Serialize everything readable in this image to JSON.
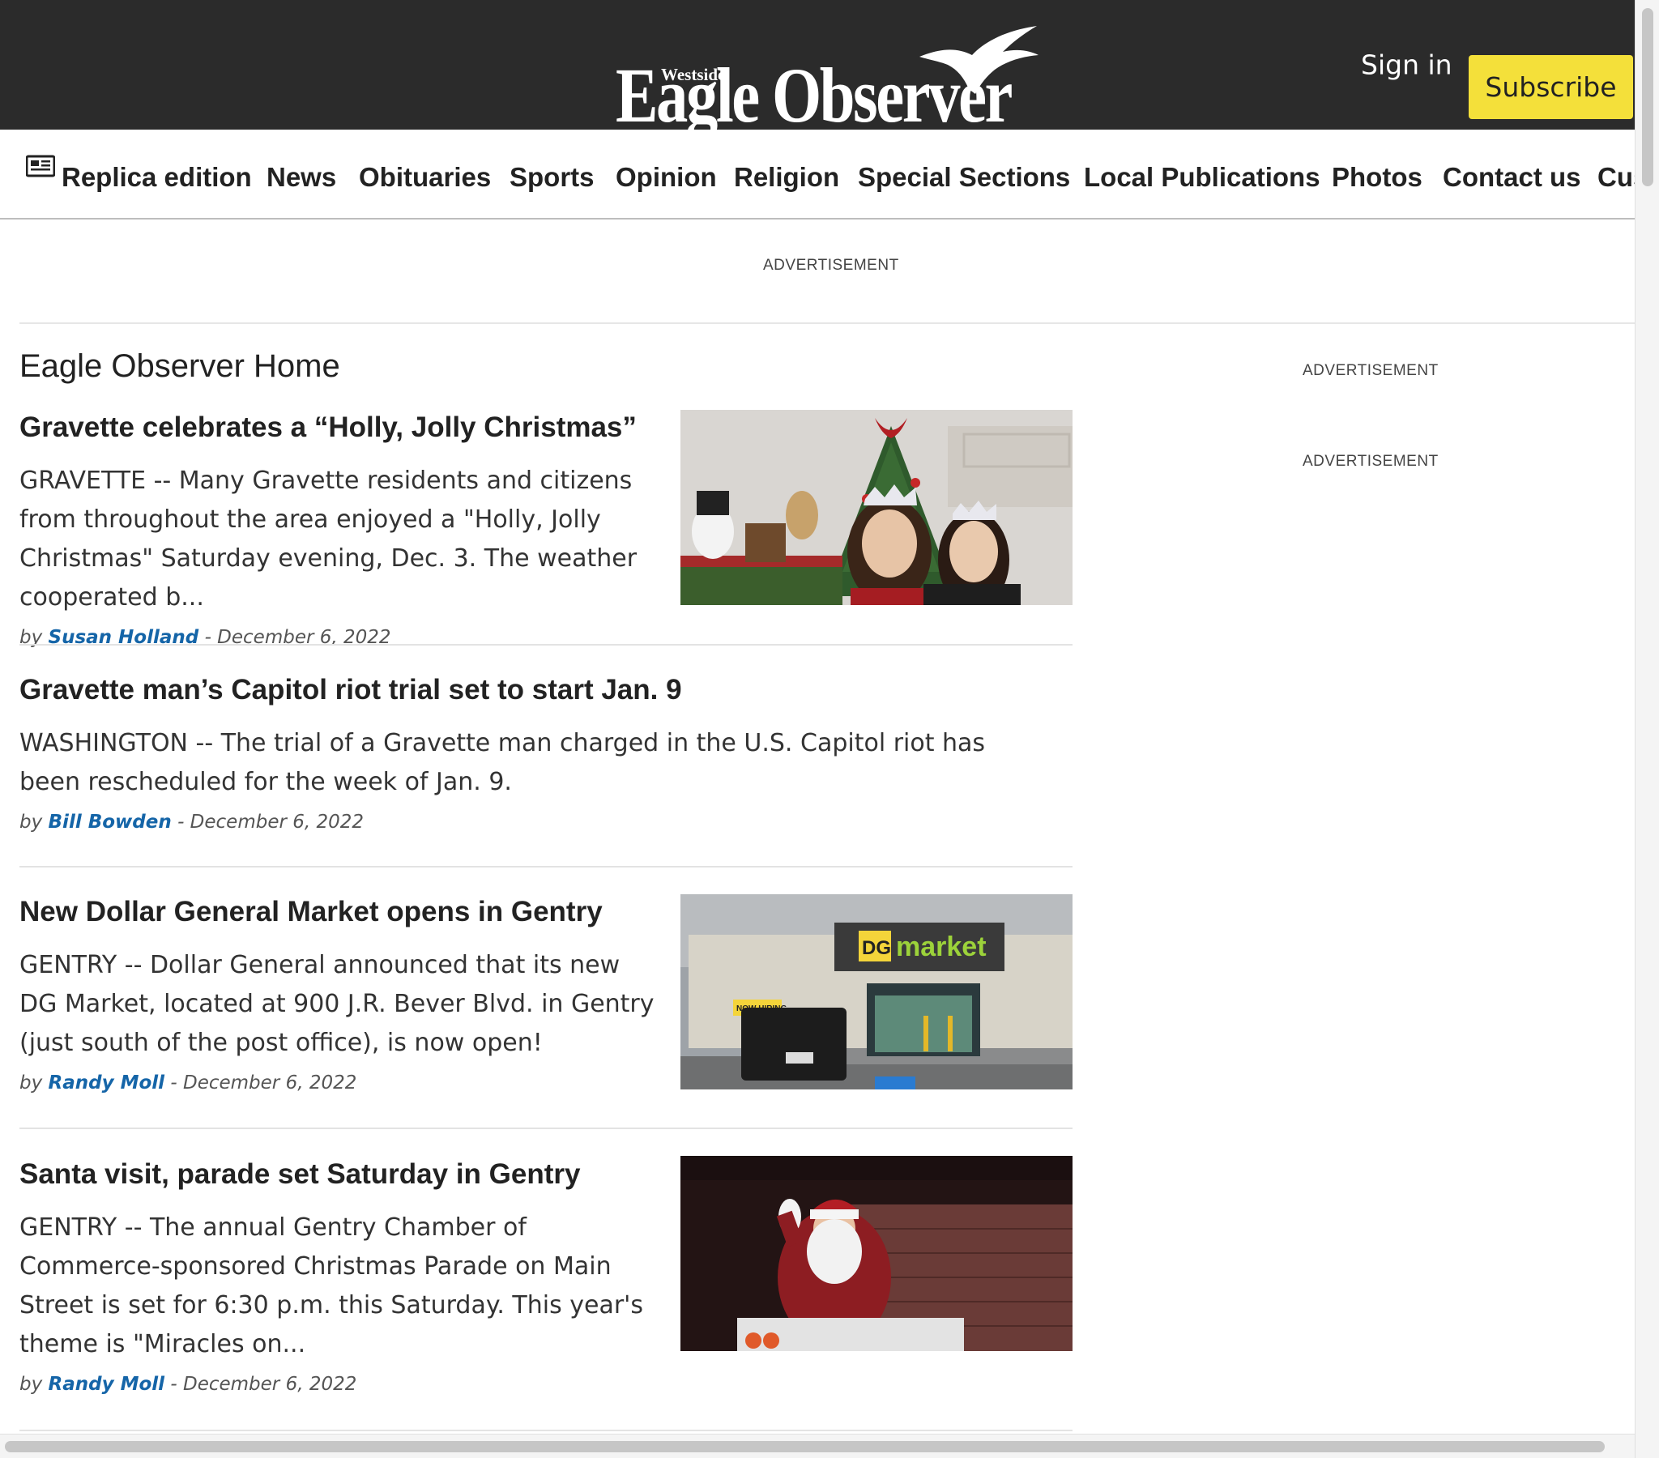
{
  "header": {
    "logo_small": "Westside",
    "logo_big": "Eagle Observer",
    "signin_label": "Sign in",
    "subscribe_label": "Subscribe",
    "bg_color": "#2b2b2b",
    "subscribe_color": "#f4e03a"
  },
  "nav": {
    "items": [
      "Replica edition",
      "News",
      "Obituaries",
      "Sports",
      "Opinion",
      "Religion",
      "Special Sections",
      "Local Publications",
      "Photos",
      "Contact us",
      "Cus"
    ],
    "replica_icon": "newspaper-icon"
  },
  "ads": {
    "top_label": "ADVERTISEMENT",
    "side_label_1": "ADVERTISEMENT",
    "side_label_2": "ADVERTISEMENT"
  },
  "main": {
    "section_title": "Eagle Observer Home",
    "articles": [
      {
        "headline": "Gravette celebrates a “Holly, Jolly Christmas”",
        "summary": "GRAVETTE -- Many Gravette residents and citizens from throughout the area enjoyed a \"Holly, Jolly Christmas\" Saturday evening, Dec. 3. The weather cooperated b...",
        "by": "by",
        "author": "Susan Holland",
        "date": "- December 6, 2022",
        "image": "christmas-tree-photo"
      },
      {
        "headline": "Gravette man’s Capitol riot trial set to start Jan. 9",
        "summary": "WASHINGTON -- The trial of a Gravette man charged in the U.S. Capitol riot has been rescheduled for the week of Jan. 9.",
        "by": "by",
        "author": "Bill Bowden",
        "date": "- December 6, 2022"
      },
      {
        "headline": "New Dollar General Market opens in Gentry",
        "summary": "GENTRY -- Dollar General announced that its new DG Market, located at 900 J.R. Bever Blvd. in Gentry (just south of the post office), is now open!",
        "by": "by",
        "author": "Randy Moll",
        "date": "- December 6, 2022",
        "image": "dg-market-photo",
        "image_text_dg": "DG",
        "image_text_market": "market",
        "image_text_hiring": "NOW HIRING"
      },
      {
        "headline": "Santa visit, parade set Saturday in Gentry",
        "summary": "GENTRY -- The annual Gentry Chamber of Commerce-sponsored Christmas Parade on Main Street is set for 6:30 p.m. this Saturday. This year's theme is \"Miracles on...",
        "by": "by",
        "author": "Randy Moll",
        "date": "- December 6, 2022",
        "image": "santa-parade-photo"
      }
    ]
  }
}
